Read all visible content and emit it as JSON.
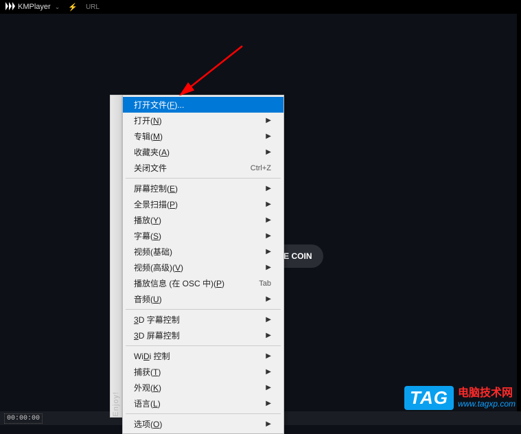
{
  "titlebar": {
    "app_name": "KMPlayer",
    "url_label": "URL"
  },
  "brand": {
    "suffix": "er"
  },
  "buttons": {
    "open_file_hint": "e",
    "free_coin": "FREE COIN"
  },
  "timecode": "00:00:00",
  "enjoy": "Enjoy!",
  "menu": {
    "items": [
      {
        "label_pre": "打开文件(",
        "underline": "F",
        "label_post": ")...",
        "highlighted": true
      },
      {
        "label_pre": "打开(",
        "underline": "N",
        "label_post": ")",
        "arrow": true
      },
      {
        "label_pre": "专辑(",
        "underline": "M",
        "label_post": ")",
        "arrow": true
      },
      {
        "label_pre": "收藏夹(",
        "underline": "A",
        "label_post": ")",
        "arrow": true
      },
      {
        "label_pre": "关闭文件",
        "underline": "",
        "label_post": "",
        "shortcut": "Ctrl+Z"
      }
    ],
    "group2": [
      {
        "label_pre": "屏幕控制(",
        "underline": "E",
        "label_post": ")",
        "arrow": true
      },
      {
        "label_pre": "全景扫描(",
        "underline": "P",
        "label_post": ")",
        "arrow": true
      },
      {
        "label_pre": "播放(",
        "underline": "Y",
        "label_post": ")",
        "arrow": true
      },
      {
        "label_pre": "字幕(",
        "underline": "S",
        "label_post": ")",
        "arrow": true
      },
      {
        "label_pre": "视频(基础)",
        "underline": "",
        "label_post": "",
        "arrow": true
      },
      {
        "label_pre": "视频(高级)(",
        "underline": "V",
        "label_post": ")",
        "arrow": true
      },
      {
        "label_pre": "播放信息 (在 OSC 中)(",
        "underline": "P",
        "label_post": ")",
        "shortcut": "Tab"
      },
      {
        "label_pre": "音频(",
        "underline": "U",
        "label_post": ")",
        "arrow": true
      }
    ],
    "group3": [
      {
        "label_pre": "",
        "underline": "3",
        "label_post": "D 字幕控制",
        "arrow": true
      },
      {
        "label_pre": "",
        "underline": "3",
        "label_post": "D 屏幕控制",
        "arrow": true
      }
    ],
    "group4": [
      {
        "label_pre": "Wi",
        "underline": "D",
        "label_post": "i 控制",
        "arrow": true
      },
      {
        "label_pre": "捕获(",
        "underline": "T",
        "label_post": ")",
        "arrow": true
      },
      {
        "label_pre": "外观(",
        "underline": "K",
        "label_post": ")",
        "arrow": true
      },
      {
        "label_pre": "语言(",
        "underline": "L",
        "label_post": ")",
        "arrow": true
      }
    ],
    "group5": [
      {
        "label_pre": "选项(",
        "underline": "O",
        "label_post": ")",
        "arrow": true
      }
    ]
  },
  "watermark": {
    "tag": "TAG",
    "line1": "电脑技术网",
    "line2": "www.tagxp.com"
  }
}
